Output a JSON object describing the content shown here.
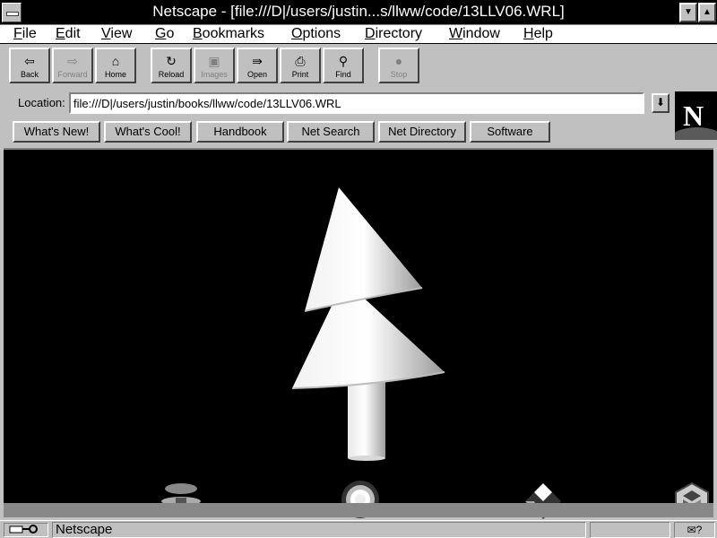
{
  "window": {
    "title": "Netscape - [file:///D|/users/justin...s/llww/code/13LLV06.WRL]",
    "minimize_glyph": "▼",
    "maximize_glyph": "▲"
  },
  "menu": [
    "File",
    "Edit",
    "View",
    "Go",
    "Bookmarks",
    "Options",
    "Directory",
    "Window",
    "Help"
  ],
  "toolbar": [
    {
      "label": "Back",
      "icon": "⇦",
      "enabled": true
    },
    {
      "label": "Forward",
      "icon": "⇨",
      "enabled": false
    },
    {
      "label": "Home",
      "icon": "⌂",
      "enabled": true
    },
    {
      "label": "Reload",
      "icon": "↻",
      "enabled": true
    },
    {
      "label": "Images",
      "icon": "▣",
      "enabled": false
    },
    {
      "label": "Open",
      "icon": "⇛",
      "enabled": true
    },
    {
      "label": "Print",
      "icon": "⎙",
      "enabled": true
    },
    {
      "label": "Find",
      "icon": "⚲",
      "enabled": true
    },
    {
      "label": "Stop",
      "icon": "●",
      "enabled": false
    }
  ],
  "location": {
    "label": "Location:",
    "value": "file:///D|/users/justin/books/llww/code/13LLV06.WRL",
    "dropdown_glyph": "⬇"
  },
  "logo": {
    "letter": "N"
  },
  "directory_buttons": [
    "What's New!",
    "What's Cool!",
    "Handbook",
    "Net Search",
    "Net Directory",
    "Software"
  ],
  "status": {
    "security_icon": "key-icon",
    "text": "Netscape",
    "mail_glyph": "✉?"
  },
  "scene": {
    "object": "tree",
    "background": "#000000"
  }
}
